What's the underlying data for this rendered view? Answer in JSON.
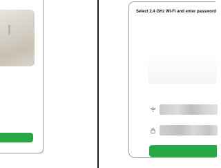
{
  "left_screen": {
    "caption": "",
    "button_label": ""
  },
  "right_screen": {
    "title": "Select 2.4 GHz Wi-Fi and enter password",
    "subtitle": "",
    "link": "",
    "band_rows": [
      {
        "left": "",
        "right": ""
      },
      {
        "left": "",
        "right": ""
      }
    ],
    "wifi_field": {
      "placeholder": "",
      "value": "",
      "icon": "wifi-icon"
    },
    "password_field": {
      "placeholder": "",
      "value": "",
      "icon": "lock-icon"
    },
    "next_button_label": ""
  },
  "colors": {
    "accent_green": "#27a844",
    "link_blue": "#3a77d8"
  }
}
